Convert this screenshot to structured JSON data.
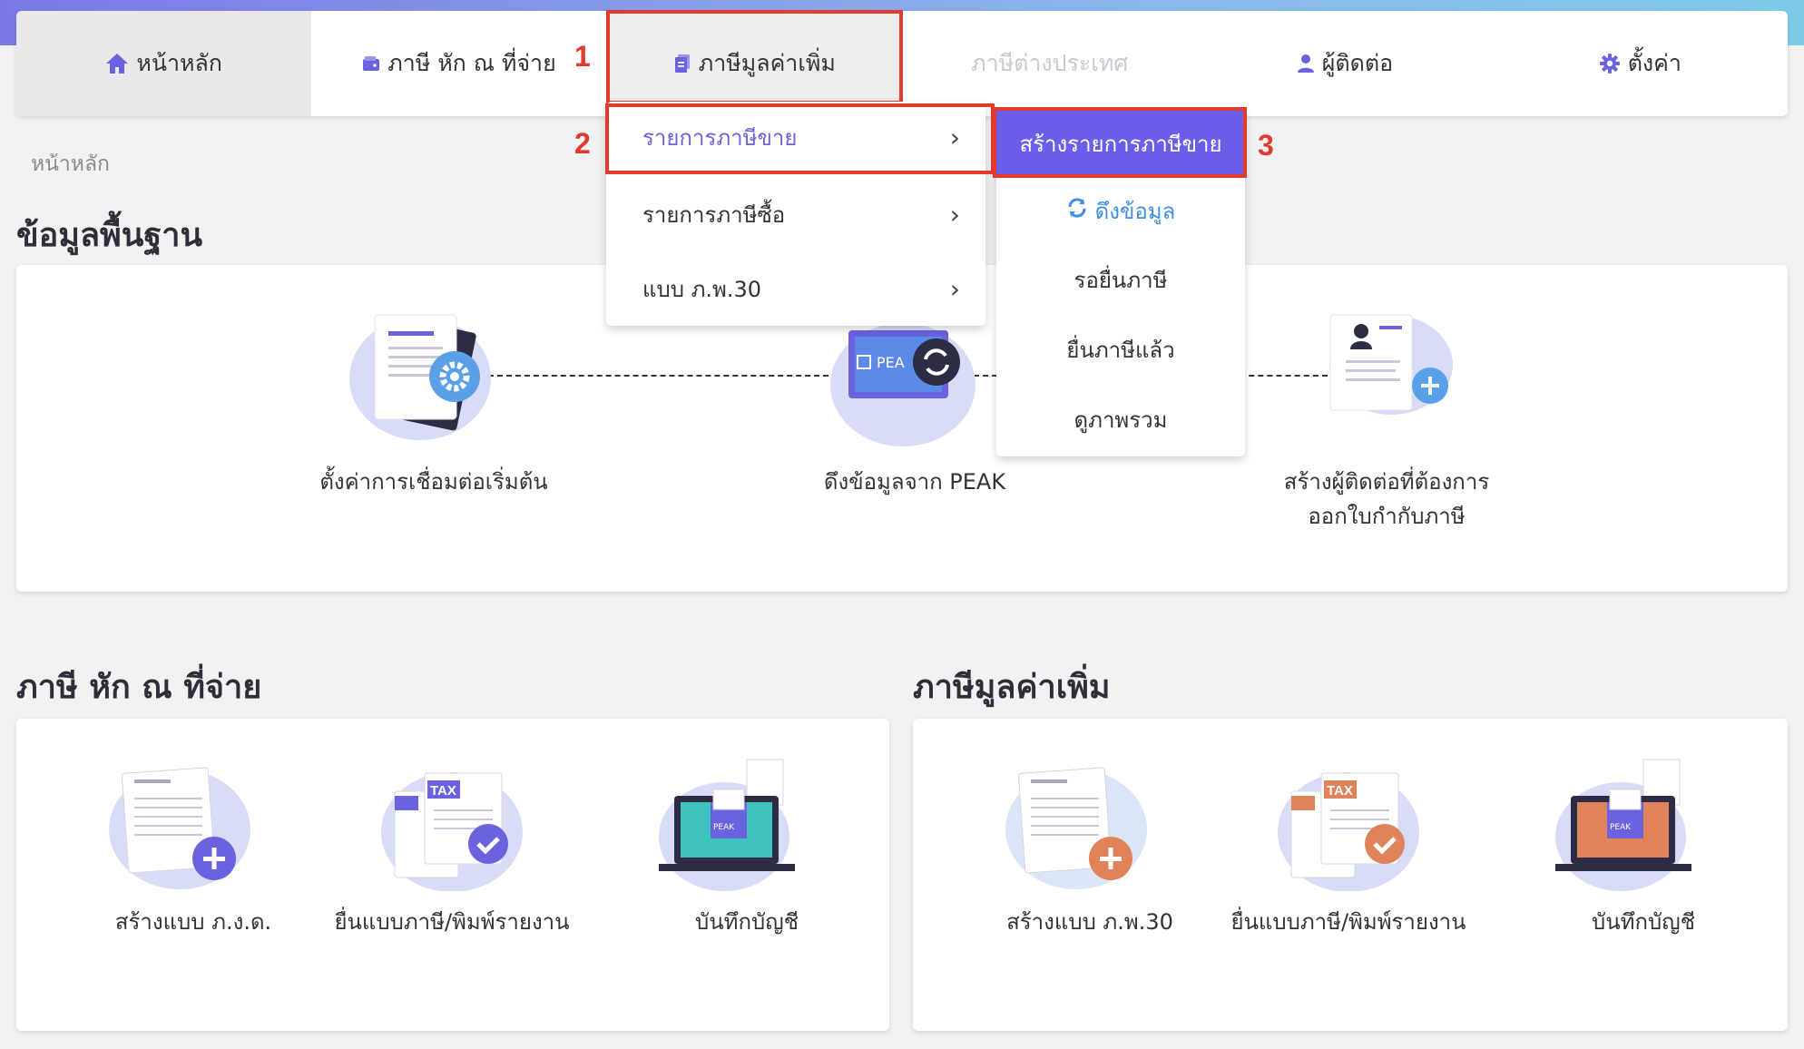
{
  "colors": {
    "accent": "#6b62e0",
    "highlight": "#e23b2e",
    "primary_button": "#6b5ee8",
    "link": "#3e8ee6",
    "vat_illustration": "#e0835a",
    "wht_illustration": "#6b62e0"
  },
  "nav": {
    "items": [
      {
        "label": "หน้าหลัก",
        "icon": "home-icon"
      },
      {
        "label": "ภาษี หัก ณ ที่จ่าย",
        "icon": "wallet-icon"
      },
      {
        "label": "ภาษีมูลค่าเพิ่ม",
        "icon": "document-icon"
      },
      {
        "label": "ภาษีต่างประเทศ",
        "icon": ""
      },
      {
        "label": "ผู้ติดต่อ",
        "icon": "user-icon"
      },
      {
        "label": "ตั้งค่า",
        "icon": "gear-icon"
      }
    ]
  },
  "steps": [
    "1",
    "2",
    "3"
  ],
  "breadcrumb": "หน้าหลัก",
  "basics": {
    "title": "ข้อมูลพื้นฐาน",
    "items": [
      {
        "label": "ตั้งค่าการเชื่อมต่อเริ่มต้น",
        "icon": "document-settings-icon"
      },
      {
        "label": "ดึงข้อมูลจาก PEAK",
        "icon": "peak-sync-icon",
        "logo_text": "PEA"
      },
      {
        "label_line1": "สร้างผู้ติดต่อที่ต้องการ",
        "label_line2": "ออกใบกำกับภาษี",
        "icon": "contact-add-icon"
      }
    ]
  },
  "wht": {
    "title": "ภาษี หัก ณ ที่จ่าย",
    "items": [
      {
        "label": "สร้างแบบ ภ.ง.ด.",
        "icon": "form-add-icon"
      },
      {
        "label": "ยื่นแบบภาษี/พิมพ์รายงาน",
        "icon": "tax-check-icon",
        "badge": "TAX"
      },
      {
        "label": "บันทึกบัญชี",
        "icon": "laptop-peak-icon",
        "logo_text": "PEAK"
      }
    ]
  },
  "vat": {
    "title": "ภาษีมูลค่าเพิ่ม",
    "items": [
      {
        "label": "สร้างแบบ ภ.พ.30",
        "icon": "form-add-icon"
      },
      {
        "label": "ยื่นแบบภาษี/พิมพ์รายงาน",
        "icon": "tax-check-icon",
        "badge": "TAX"
      },
      {
        "label": "บันทึกบัญชี",
        "icon": "laptop-peak-icon",
        "logo_text": "PEAK"
      }
    ]
  },
  "vat_menu": {
    "items": [
      {
        "label": "รายการภาษีขาย",
        "chevron": "›"
      },
      {
        "label": "รายการภาษีซื้อ",
        "chevron": "›"
      },
      {
        "label": "แบบ ภ.พ.30",
        "chevron": "›"
      }
    ]
  },
  "sales_submenu": {
    "items": [
      {
        "label": "สร้างรายการภาษีขาย"
      },
      {
        "label": "ดึงข้อมูล",
        "icon": "refresh-icon"
      },
      {
        "label": "รอยื่นภาษี"
      },
      {
        "label": "ยื่นภาษีแล้ว"
      },
      {
        "label": "ดูภาพรวม"
      }
    ]
  }
}
